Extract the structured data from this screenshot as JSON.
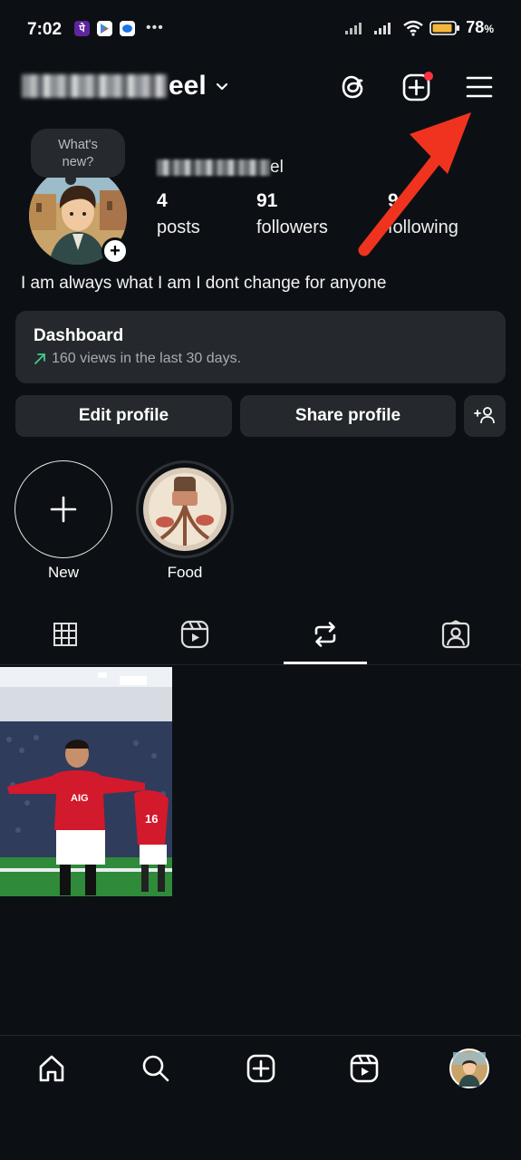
{
  "status_bar": {
    "time": "7:02",
    "battery": "78",
    "battery_unit": "%",
    "apps": [
      "phonepe-icon",
      "play-store-icon",
      "messages-icon"
    ]
  },
  "header": {
    "username_visible_suffix": "eel",
    "icons": [
      "threads-icon",
      "create-icon",
      "menu-icon"
    ],
    "notification_dot_color": "#ff3040"
  },
  "profile": {
    "note": "What's new?",
    "display_name_visible_suffix": "el",
    "stats": [
      {
        "value": "4",
        "label": "posts"
      },
      {
        "value": "91",
        "label": "followers"
      },
      {
        "value": "9",
        "label": "following"
      }
    ],
    "bio": "I am always what I am I dont change for anyone"
  },
  "dashboard": {
    "title": "Dashboard",
    "subtitle": "160 views in the last 30 days."
  },
  "actions": {
    "edit_profile": "Edit profile",
    "share_profile": "Share profile"
  },
  "highlights": [
    {
      "label": "New"
    },
    {
      "label": "Food"
    }
  ],
  "tabs": [
    "grid-icon",
    "reels-icon",
    "reposts-icon",
    "tagged-icon"
  ],
  "selected_tab": "reposts-icon",
  "bottom_nav": [
    "home-icon",
    "search-icon",
    "create-icon",
    "reels-icon",
    "profile-avatar"
  ],
  "colors": {
    "background": "#0c1014",
    "surface": "#25282c",
    "annotation_arrow": "#f0331f",
    "trend_green": "#3ecf8e"
  }
}
